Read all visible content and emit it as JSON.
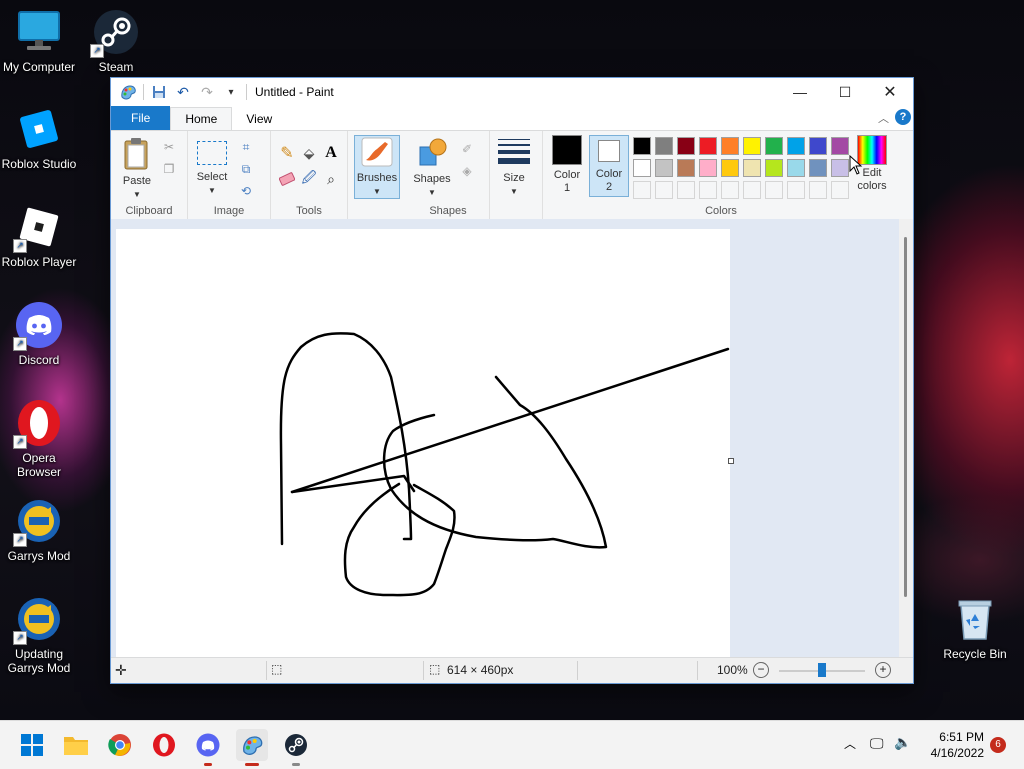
{
  "desktop": {
    "icons": [
      {
        "label": "My Computer"
      },
      {
        "label": "Steam"
      },
      {
        "label": "Roblox Studio"
      },
      {
        "label": "Roblox Player"
      },
      {
        "label": "Discord"
      },
      {
        "label": "Opera\nBrowser"
      },
      {
        "label": "Garrys Mod"
      },
      {
        "label": "Updating\nGarrys Mod"
      },
      {
        "label": "Recycle Bin"
      }
    ]
  },
  "paint": {
    "title": "Untitled - Paint",
    "tabs": {
      "file": "File",
      "home": "Home",
      "view": "View"
    },
    "groups": {
      "clipboard": {
        "label": "Clipboard",
        "paste": "Paste"
      },
      "image": {
        "label": "Image",
        "select": "Select"
      },
      "tools": {
        "label": "Tools"
      },
      "brushes": {
        "label": "Brushes"
      },
      "shapes": {
        "label": "Shapes",
        "shapes_btn": "Shapes"
      },
      "size": {
        "label": "Size"
      },
      "colors": {
        "label": "Colors",
        "color1": "Color\n1",
        "color2": "Color\n2",
        "edit_colors": "Edit\ncolors",
        "color1_value": "#000000",
        "color2_value": "#ffffff",
        "palette_row1": [
          "#000000",
          "#7f7f7f",
          "#880015",
          "#ed1c24",
          "#ff7f27",
          "#fff200",
          "#22b14c",
          "#00a2e8",
          "#3f48cc",
          "#a349a4"
        ],
        "palette_row2": [
          "#ffffff",
          "#c3c3c3",
          "#b97a57",
          "#ffaec9",
          "#ffc90e",
          "#efe4b0",
          "#b5e61d",
          "#99d9ea",
          "#7092be",
          "#c8bfe7"
        ]
      }
    },
    "status": {
      "dimensions": "614 × 460px",
      "zoom": "100%"
    }
  },
  "taskbar": {
    "time": "6:51 PM",
    "date": "4/16/2022",
    "notifications": "6"
  }
}
